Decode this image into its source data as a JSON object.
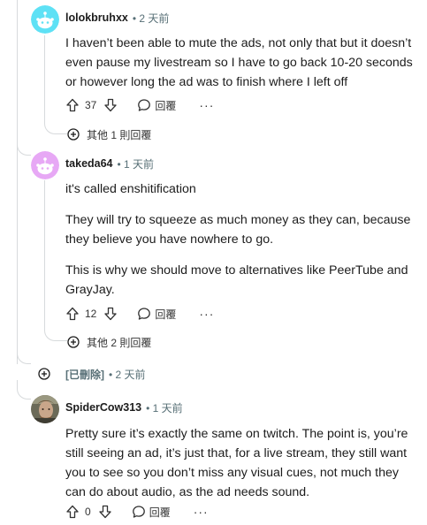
{
  "comments": [
    {
      "author": "lolokbruhxx",
      "time": "• 2 天前",
      "paragraphs": [
        "I haven’t been able to mute the ads, not only that but it doesn’t even pause my livestream so I have to go back 10-20 seconds or however long the ad was to finish where I left off"
      ],
      "votes": "37",
      "reply_label": "回覆",
      "more_label": "···",
      "more_replies": "其他 1 則回覆",
      "avatar_color": "#5ee1f5"
    },
    {
      "author": "takeda64",
      "time": "• 1 天前",
      "paragraphs": [
        "it's called enshitification",
        "They will try to squeeze as much money as they can, because they believe you have nowhere to go.",
        "This is why we should move to alternatives like PeerTube and GrayJay."
      ],
      "votes": "12",
      "reply_label": "回覆",
      "more_label": "···",
      "more_replies": "其他 2 則回覆",
      "avatar_color": "#e7a8f5"
    },
    {
      "author": "SpiderCow313",
      "time": "• 1 天前",
      "paragraphs": [
        "Pretty sure it’s exactly the same on twitch. The point is, you’re still seeing an ad, it’s just that, for a live stream, they still want you to see so you don’t miss any visual cues, not much they can do about audio, as the ad needs sound."
      ],
      "votes": "0",
      "reply_label": "回覆",
      "more_label": "···"
    }
  ],
  "deleted": {
    "label": "[已刪除]",
    "time": "• 2 天前"
  },
  "icons": {
    "upvote": "arrow-up-icon",
    "downvote": "arrow-down-icon",
    "reply": "speech-bubble-icon",
    "expand": "plus-circle-icon"
  }
}
